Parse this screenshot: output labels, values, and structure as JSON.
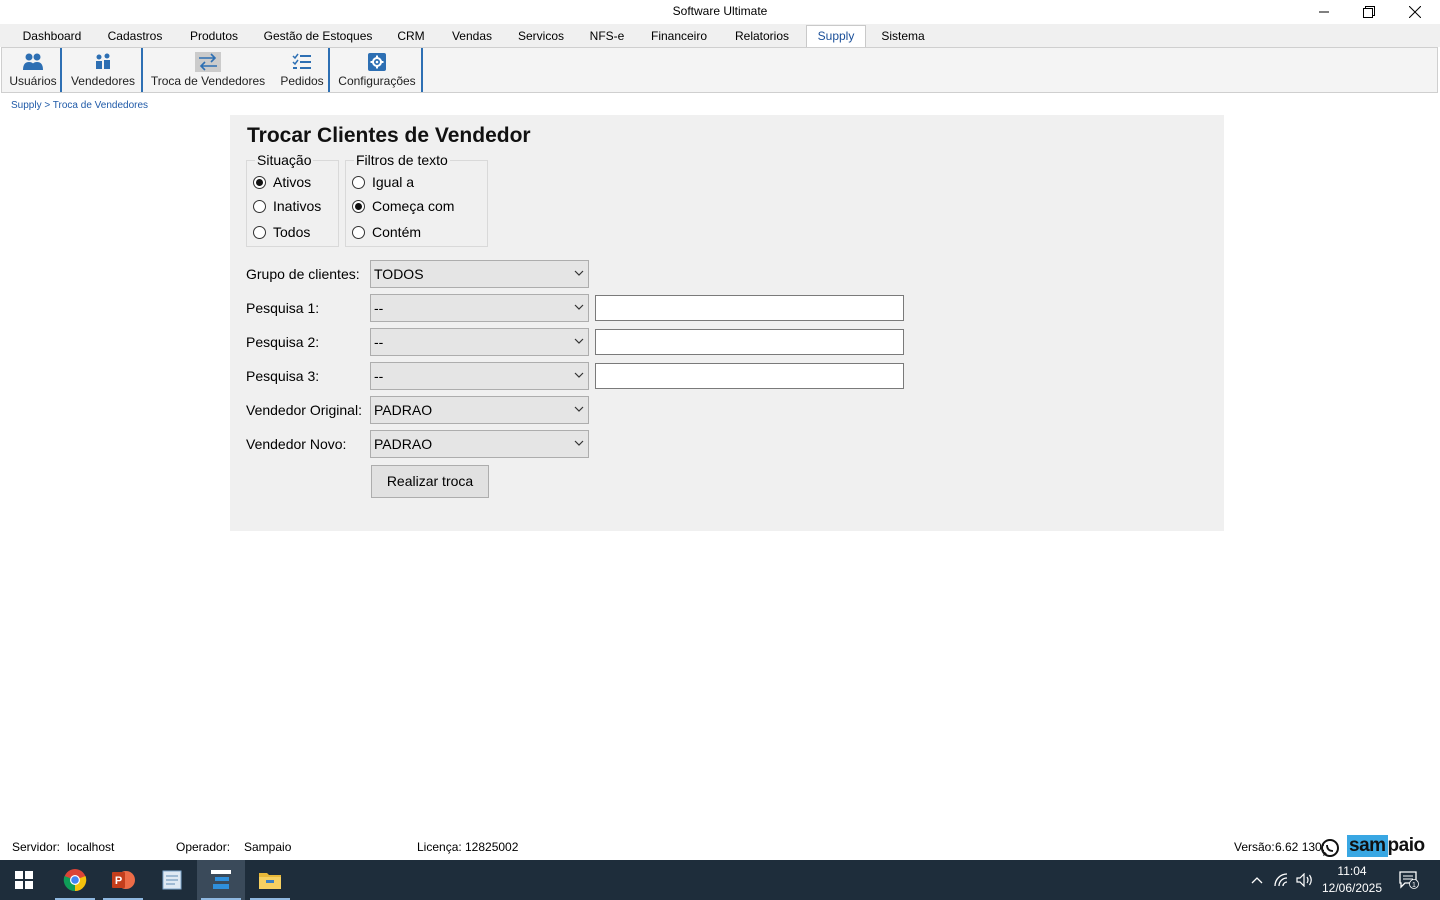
{
  "window": {
    "title": "Software Ultimate"
  },
  "menu_tabs": [
    {
      "label": "Dashboard"
    },
    {
      "label": "Cadastros"
    },
    {
      "label": "Produtos"
    },
    {
      "label": "Gestão de Estoques"
    },
    {
      "label": "CRM"
    },
    {
      "label": "Vendas"
    },
    {
      "label": "Servicos"
    },
    {
      "label": "NFS-e"
    },
    {
      "label": "Financeiro"
    },
    {
      "label": "Relatorios"
    },
    {
      "label": "Supply",
      "active": true
    },
    {
      "label": "Sistema"
    }
  ],
  "ribbon": [
    {
      "label": "Usuários",
      "icon": "users-icon"
    },
    {
      "label": "Vendedores",
      "icon": "sellers-icon"
    },
    {
      "label": "Troca de Vendedores",
      "icon": "swap-arrows-icon",
      "active": true
    },
    {
      "label": "Pedidos",
      "icon": "list-icon"
    },
    {
      "label": "Configurações",
      "icon": "gear-icon"
    }
  ],
  "breadcrumb": "Supply > Troca de Vendedores",
  "form": {
    "title": "Trocar Clientes de Vendedor",
    "situacao": {
      "legend": "Situação",
      "options": [
        "Ativos",
        "Inativos",
        "Todos"
      ],
      "selected": "Ativos"
    },
    "filtros": {
      "legend": "Filtros de texto",
      "options": [
        "Igual a",
        "Começa com",
        "Contém"
      ],
      "selected": "Começa com"
    },
    "grupo": {
      "label": "Grupo de clientes:",
      "value": "TODOS"
    },
    "pesquisa1": {
      "label": "Pesquisa 1:",
      "value": "--",
      "text": ""
    },
    "pesquisa2": {
      "label": "Pesquisa 2:",
      "value": "--",
      "text": ""
    },
    "pesquisa3": {
      "label": "Pesquisa 3:",
      "value": "--",
      "text": ""
    },
    "vendedor_original": {
      "label": "Vendedor Original:",
      "value": "PADRAO"
    },
    "vendedor_novo": {
      "label": "Vendedor Novo:",
      "value": "PADRAO"
    },
    "submit_label": "Realizar troca"
  },
  "status": {
    "servidor_label": "Servidor:",
    "servidor": "localhost",
    "operador_label": "Operador:",
    "operador": "Sampaio",
    "licenca_label": "Licença:",
    "licenca": "12825002",
    "versao_label": "Versão:",
    "versao": "6.62 130:",
    "logo_a": "sam",
    "logo_b": "paio"
  },
  "taskbar": {
    "time": "11:04",
    "date": "12/06/2025",
    "notification_count": "1"
  },
  "colors": {
    "accent": "#2d6fb3",
    "active_tab_text": "#1a4f99",
    "taskbar": "#1e2d3b",
    "logo_blue": "#39a7e3"
  }
}
